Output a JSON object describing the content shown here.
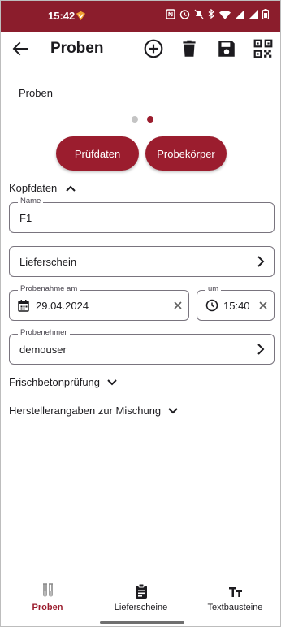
{
  "status_bar": {
    "time": "15:42"
  },
  "app_bar": {
    "title": "Proben",
    "actions": [
      "add-circle-icon",
      "trash-icon",
      "save-icon",
      "qr-code-icon"
    ]
  },
  "section_label": "Proben",
  "pager": {
    "count": 2,
    "active": 2
  },
  "buttons": {
    "pruefdaten": "Prüfdaten",
    "probekoerper": "Probekörper"
  },
  "kopfdaten": {
    "header": "Kopfdaten",
    "expanded": true,
    "name": {
      "label": "Name",
      "value": "F1"
    },
    "lieferschein": {
      "value": "Lieferschein"
    },
    "probenahme": {
      "label": "Probenahme am",
      "value": "29.04.2024"
    },
    "um": {
      "label": "um",
      "value": "15:40"
    },
    "probenehmer": {
      "label": "Probenehmer",
      "value": "demouser"
    }
  },
  "sections": [
    {
      "label": "Frischbetonprüfung",
      "expanded": false
    },
    {
      "label": "Herstellerangaben zur Mischung",
      "expanded": false
    }
  ],
  "bottom_nav": {
    "items": [
      {
        "label": "Proben",
        "icon": "test-tubes-icon",
        "active": true
      },
      {
        "label": "Lieferscheine",
        "icon": "clipboard-icon",
        "active": false
      },
      {
        "label": "Textbausteine",
        "icon": "text-size-icon",
        "active": false
      }
    ]
  },
  "colors": {
    "primary": "#9b1d2e",
    "status_bar": "#8b1d2c",
    "dot_inactive": "#c4c4c4",
    "outline": "#79747e"
  }
}
